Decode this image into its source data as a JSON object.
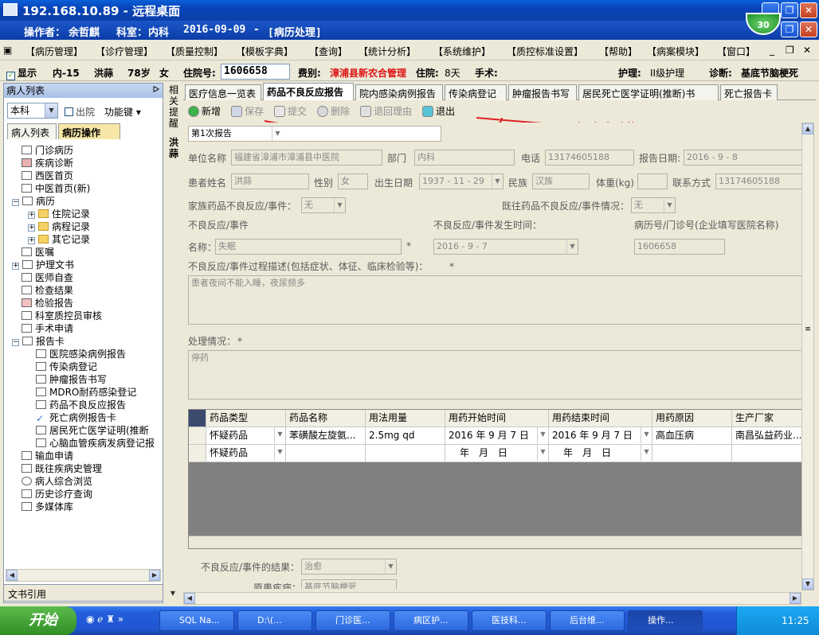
{
  "window": {
    "title": "192.168.10.89 - 远程桌面",
    "badge": "30"
  },
  "operator": {
    "label": "操作者：",
    "name": "余哲麒",
    "dept_label": "科室：",
    "dept": "内科",
    "date": "2016-09-09",
    "module": "[病历处理]"
  },
  "menu": [
    "【病历管理】",
    "【诊疗管理】",
    "【质量控制】",
    "【模板字典】",
    "【查询】",
    "【统计分析】",
    "【系统维护】",
    "【质控标准设置】",
    "【帮助】",
    "【病案模块】",
    "【窗口】"
  ],
  "patient": {
    "show": "显示",
    "ward": "内-15",
    "name": "洪蒜",
    "age": "78岁",
    "sex": "女",
    "inhospital_label": "住院号:",
    "inhospital_no": "1606658",
    "fee_label": "费别:",
    "fee": "漳浦县新农合管理",
    "days_label": "住院:",
    "days": "8天",
    "surgery_label": "手术:",
    "nursing_label": "护理:",
    "nursing": "II级护理",
    "diag_label": "诊断:",
    "diag": "基底节脑梗死"
  },
  "left": {
    "header": "病人列表",
    "dept": "本科",
    "discharge": "出院",
    "func_key": "功能键",
    "tabs": [
      "病人列表",
      "病历操作"
    ],
    "footer": "文书引用",
    "tree": [
      "门诊病历",
      "疾病诊断",
      "西医首页",
      "中医首页(新)",
      "病历",
      "住院记录",
      "病程记录",
      "其它记录",
      "医嘱",
      "护理文书",
      "医师自查",
      "检查结果",
      "检验报告",
      "科室质控员审核",
      "手术申请",
      "报告卡",
      "医院感染病例报告",
      "传染病登记",
      "肿瘤报告书写",
      "MDRO耐药感染登记",
      "药品不良反应报告",
      "死亡病例报告卡",
      "居民死亡医学证明(推断",
      "心脑血管疾病发病登记报",
      "输血申请",
      "既往疾病史管理",
      "病人综合浏览",
      "历史诊疗查询",
      "多媒体库"
    ]
  },
  "side": {
    "text": "相关提醒",
    "name": "洪蒜"
  },
  "tabs": [
    "医疗信息一览表",
    "药品不良反应报告",
    "院内感染病例报告",
    "传染病登记",
    "肿瘤报告书写",
    "居民死亡医学证明(推断)书",
    "死亡报告卡"
  ],
  "toolbar": {
    "add": "新增",
    "save": "保存",
    "submit": "提交",
    "delete": "删除",
    "reason": "退回理由",
    "exit": "退出"
  },
  "annotation": "打印功能",
  "form": {
    "report_no": "第1次报告",
    "unit_label": "单位名称",
    "unit": "福建省漳浦市漳浦县中医院",
    "dept_label": "部门",
    "dept": "内科",
    "phone_label": "电话",
    "phone": "13174605188",
    "date_label": "报告日期:",
    "date": "2016 - 9 - 8",
    "pname_label": "患者姓名",
    "pname": "洪蒜",
    "sex_label": "性别",
    "sex": "女",
    "birth_label": "出生日期",
    "birth": "1937 - 11 - 29",
    "nation_label": "民族",
    "nation": "汉族",
    "weight_label": "体重(kg)",
    "contact_label": "联系方式",
    "contact": "13174605188",
    "family_label": "家族药品不良反应/事件：",
    "family": "无",
    "past_label": "既往药品不良反应/事件情况：",
    "past": "无",
    "event_label": "不良反应/事件",
    "time_label": "不良反应/事件发生时间：",
    "record_label": "病历号/门诊号(企业填写医院名称)",
    "name_label": "名称：",
    "name": "失眠",
    "time": "2016 - 9 - 7",
    "record": "1606658",
    "desc_label": "不良反应/事件过程描述(包括症状、体征、临床检验等)：",
    "desc": "患者夜间不能入睡，夜尿频多",
    "handle_label": "处理情况：",
    "handle": "停药",
    "result_label": "不良反应/事件的结果：",
    "result": "治愈",
    "origin_label": "原患疾病：",
    "origin": "基底节脑梗死"
  },
  "grid": {
    "headers": [
      "药品类型",
      "药品名称",
      "用法用量",
      "用药开始时间",
      "用药结束时间",
      "用药原因",
      "生产厂家"
    ],
    "rows": [
      [
        "怀疑药品",
        "苯磺酸左旋氨...",
        "2.5mg qd",
        "2016 年 9 月 7 日",
        "2016 年 9 月 7 日",
        "高血压病",
        "南昌弘益药业..."
      ],
      [
        "怀疑药品",
        "",
        "",
        "年　月　日",
        "年　月　日",
        "",
        ""
      ]
    ]
  },
  "taskbar": {
    "start": "开始",
    "items": [
      "SQL Na...",
      "D:\\(...",
      "门诊医...",
      "病区护...",
      "医技科...",
      "后台维...",
      "操作..."
    ],
    "time": "11:25"
  }
}
